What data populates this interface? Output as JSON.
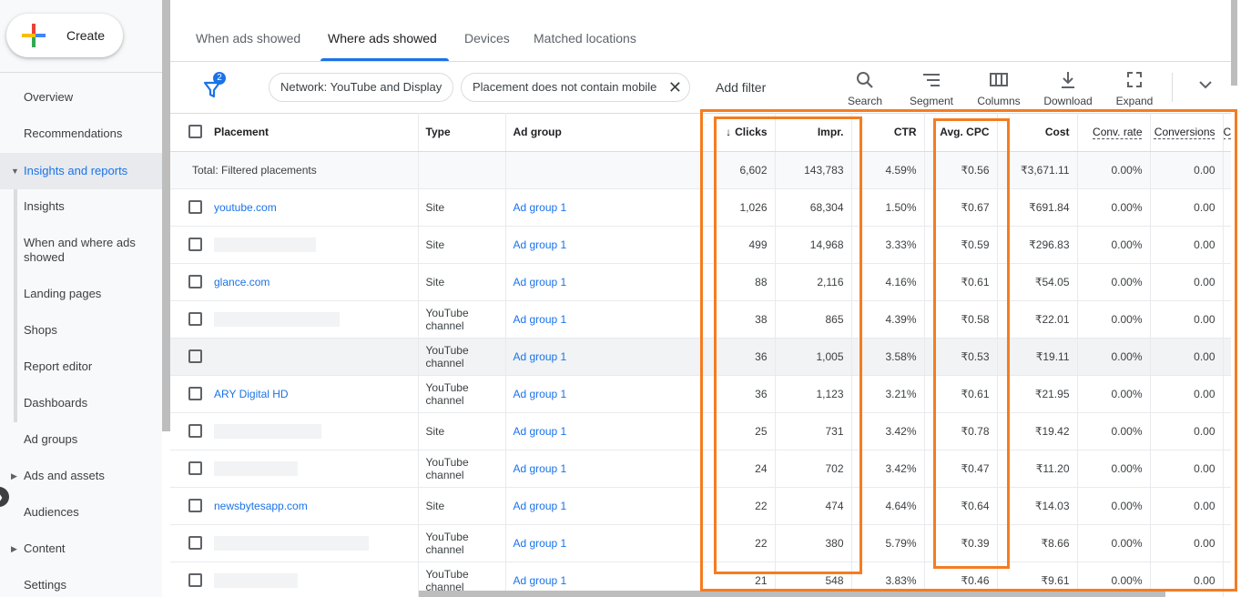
{
  "sidebar": {
    "create_label": "Create",
    "items": [
      {
        "label": "Overview"
      },
      {
        "label": "Recommendations"
      },
      {
        "label": "Insights and reports"
      },
      {
        "label": "Insights"
      },
      {
        "label": "When and where ads showed"
      },
      {
        "label": "Landing pages"
      },
      {
        "label": "Shops"
      },
      {
        "label": "Report editor"
      },
      {
        "label": "Dashboards"
      },
      {
        "label": "Ad groups"
      },
      {
        "label": "Ads and assets"
      },
      {
        "label": "Audiences"
      },
      {
        "label": "Content"
      },
      {
        "label": "Settings"
      }
    ]
  },
  "tabs": [
    {
      "label": "When ads showed"
    },
    {
      "label": "Where ads showed"
    },
    {
      "label": "Devices"
    },
    {
      "label": "Matched locations"
    }
  ],
  "filterbar": {
    "filter_count": "2",
    "chips": [
      {
        "label": "Network: YouTube and Display"
      },
      {
        "label": "Placement does not contain mobile"
      }
    ],
    "chip_close": "✕",
    "add_filter": "Add filter",
    "tools": [
      {
        "label": "Search"
      },
      {
        "label": "Segment"
      },
      {
        "label": "Columns"
      },
      {
        "label": "Download"
      },
      {
        "label": "Expand"
      }
    ]
  },
  "table": {
    "headers": {
      "placement": "Placement",
      "type": "Type",
      "ad_group": "Ad group",
      "clicks": "Clicks",
      "impr": "Impr.",
      "ctr": "CTR",
      "avg_cpc": "Avg. CPC",
      "cost": "Cost",
      "conv_rate": "Conv. rate",
      "conversions": "Conversions",
      "extra": "C"
    },
    "total": {
      "label": "Total: Filtered placements",
      "clicks": "6,602",
      "impr": "143,783",
      "ctr": "4.59%",
      "avg_cpc": "₹0.56",
      "cost": "₹3,671.11",
      "conv_rate": "0.00%",
      "conversions": "0.00"
    },
    "rows": [
      {
        "placement": "youtube.com",
        "type": "Site",
        "ad_group": "Ad group 1",
        "clicks": "1,026",
        "impr": "68,304",
        "ctr": "1.50%",
        "avg_cpc": "₹0.67",
        "cost": "₹691.84",
        "conv_rate": "0.00%",
        "conversions": "0.00"
      },
      {
        "placement": "",
        "type": "Site",
        "ad_group": "Ad group 1",
        "clicks": "499",
        "impr": "14,968",
        "ctr": "3.33%",
        "avg_cpc": "₹0.59",
        "cost": "₹296.83",
        "conv_rate": "0.00%",
        "conversions": "0.00"
      },
      {
        "placement": "glance.com",
        "type": "Site",
        "ad_group": "Ad group 1",
        "clicks": "88",
        "impr": "2,116",
        "ctr": "4.16%",
        "avg_cpc": "₹0.61",
        "cost": "₹54.05",
        "conv_rate": "0.00%",
        "conversions": "0.00"
      },
      {
        "placement": "",
        "type": "YouTube channel",
        "ad_group": "Ad group 1",
        "clicks": "38",
        "impr": "865",
        "ctr": "4.39%",
        "avg_cpc": "₹0.58",
        "cost": "₹22.01",
        "conv_rate": "0.00%",
        "conversions": "0.00"
      },
      {
        "placement": "",
        "type": "YouTube channel",
        "ad_group": "Ad group 1",
        "clicks": "36",
        "impr": "1,005",
        "ctr": "3.58%",
        "avg_cpc": "₹0.53",
        "cost": "₹19.11",
        "conv_rate": "0.00%",
        "conversions": "0.00"
      },
      {
        "placement": "ARY Digital HD",
        "type": "YouTube channel",
        "ad_group": "Ad group 1",
        "clicks": "36",
        "impr": "1,123",
        "ctr": "3.21%",
        "avg_cpc": "₹0.61",
        "cost": "₹21.95",
        "conv_rate": "0.00%",
        "conversions": "0.00"
      },
      {
        "placement": "",
        "type": "Site",
        "ad_group": "Ad group 1",
        "clicks": "25",
        "impr": "731",
        "ctr": "3.42%",
        "avg_cpc": "₹0.78",
        "cost": "₹19.42",
        "conv_rate": "0.00%",
        "conversions": "0.00"
      },
      {
        "placement": "",
        "type": "YouTube channel",
        "ad_group": "Ad group 1",
        "clicks": "24",
        "impr": "702",
        "ctr": "3.42%",
        "avg_cpc": "₹0.47",
        "cost": "₹11.20",
        "conv_rate": "0.00%",
        "conversions": "0.00"
      },
      {
        "placement": "newsbytesapp.com",
        "type": "Site",
        "ad_group": "Ad group 1",
        "clicks": "22",
        "impr": "474",
        "ctr": "4.64%",
        "avg_cpc": "₹0.64",
        "cost": "₹14.03",
        "conv_rate": "0.00%",
        "conversions": "0.00"
      },
      {
        "placement": "",
        "type": "YouTube channel",
        "ad_group": "Ad group 1",
        "clicks": "22",
        "impr": "380",
        "ctr": "5.79%",
        "avg_cpc": "₹0.39",
        "cost": "₹8.66",
        "conv_rate": "0.00%",
        "conversions": "0.00"
      },
      {
        "placement": "",
        "type": "YouTube channel",
        "ad_group": "Ad group 1",
        "clicks": "21",
        "impr": "548",
        "ctr": "3.83%",
        "avg_cpc": "₹0.46",
        "cost": "₹9.61",
        "conv_rate": "0.00%",
        "conversions": "0.00"
      }
    ]
  },
  "colors": {
    "accent": "#1a73e8",
    "highlight": "#f57c20"
  }
}
